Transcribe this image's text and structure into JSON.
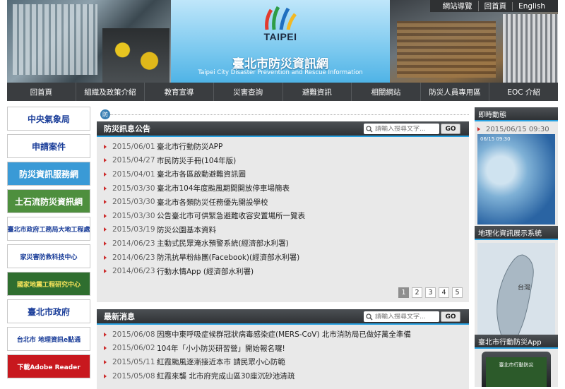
{
  "header": {
    "logo_text": "TAIPEI",
    "site_title": "臺北市防災資訊網",
    "site_subtitle": "Taipei City Disaster Prevention and Rescue Information",
    "top_links": [
      "網站導覽",
      "回首頁",
      "English"
    ]
  },
  "nav": [
    "回首頁",
    "組織及政策介紹",
    "教育宣導",
    "災害查詢",
    "避難資訊",
    "相關網站",
    "防災人員專用區",
    "EOC 介紹"
  ],
  "left_banners": [
    {
      "label": "中央氣象局",
      "color": "#1c3f9a",
      "bg": "#ffffff"
    },
    {
      "label": "申請案件",
      "color": "#1c3f9a",
      "bg": "#ffffff"
    },
    {
      "label": "防災資訊服務網",
      "color": "#ffffff",
      "bg": "#3a9ad6"
    },
    {
      "label": "土石流防災資訊網",
      "color": "#ffffff",
      "bg": "#4e8f3e"
    },
    {
      "label": "臺北市政府工務局大地工程處",
      "color": "#1c3f9a",
      "bg": "#ffffff"
    },
    {
      "label": "家災害防救科技中心",
      "color": "#1c3f9a",
      "bg": "#ffffff"
    },
    {
      "label": "國家地震工程研究中心",
      "color": "#f4e25a",
      "bg": "#2f6e2f"
    },
    {
      "label": "臺北市政府",
      "color": "#1c3f9a",
      "bg": "#ffffff"
    },
    {
      "label": "台北市 地理資訊e點通",
      "color": "#1c3f9a",
      "bg": "#ffffff"
    },
    {
      "label": "下載Adobe Reader",
      "color": "#ffffff",
      "bg": "#c8181e"
    }
  ],
  "tag_char": "防",
  "announcements": {
    "title": "防災訊息公告",
    "search_placeholder": "請輸入搜尋文字...",
    "go_label": "GO",
    "items": [
      {
        "date": "2015/06/01",
        "title": "臺北市行動防災APP"
      },
      {
        "date": "2015/04/27",
        "title": "市民防災手冊(104年版)"
      },
      {
        "date": "2015/04/01",
        "title": "臺北市各區啟動避難資訊圖"
      },
      {
        "date": "2015/03/30",
        "title": "臺北市104年度颱風期間開放停車場簡表"
      },
      {
        "date": "2015/03/30",
        "title": "臺北市各類防災任務優先開設學校"
      },
      {
        "date": "2015/03/30",
        "title": "公告臺北市可供緊急避難收容安置場所一覽表"
      },
      {
        "date": "2015/03/19",
        "title": "防災公園基本資料"
      },
      {
        "date": "2014/06/23",
        "title": "主動式民眾淹水預警系統(經濟部水利署)"
      },
      {
        "date": "2014/06/23",
        "title": "防汛抗旱粉絲團(Facebook)(經濟部水利署)"
      },
      {
        "date": "2014/06/23",
        "title": "行動水情App (經濟部水利署)"
      }
    ],
    "pages": [
      "1",
      "2",
      "3",
      "4",
      "5"
    ]
  },
  "news": {
    "title": "最新消息",
    "search_placeholder": "請輸入搜尋文字...",
    "go_label": "GO",
    "items": [
      {
        "date": "2015/06/08",
        "title": "因應中東呼吸症候群冠狀病毒感染症(MERS-CoV) 北市消防局已做好萬全準備"
      },
      {
        "date": "2015/06/02",
        "title": "104年「小小防災研習營」開始報名囉!"
      },
      {
        "date": "2015/05/11",
        "title": "紅霞颱風逐漸接近本市 請民眾小心防範"
      },
      {
        "date": "2015/05/08",
        "title": "紅霞來襲 北市府完成山區30座沉砂池清疏"
      }
    ]
  },
  "right": {
    "realtime_title": "即時動態",
    "realtime_date": "2015/06/15 09:30",
    "sat_stamp": "06/15 09:30",
    "map_title": "地理化資訊展示系統",
    "map_label": "台灣",
    "app_title": "臺北市行動防災App",
    "app_screen_text": "臺北市行動防災"
  }
}
